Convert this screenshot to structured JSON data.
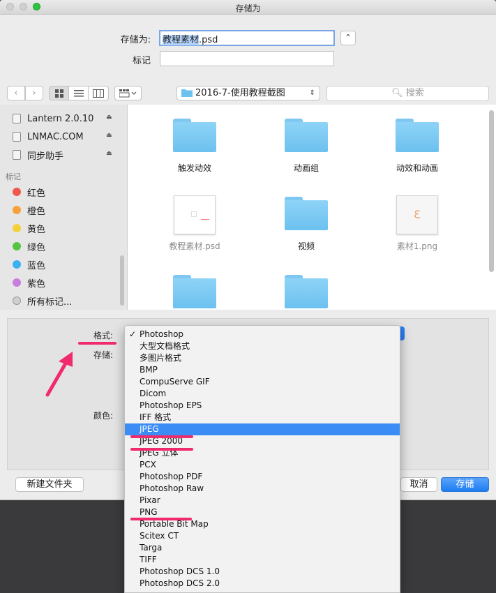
{
  "window": {
    "title": "存储为"
  },
  "save_as": {
    "label": "存储为:",
    "filename_selected": "教程素材",
    "filename_ext": ".psd"
  },
  "tags_field": {
    "label": "标记",
    "value": ""
  },
  "toolbar": {
    "location": "2016-7-使用教程截图",
    "search_placeholder": "搜索"
  },
  "sidebar": {
    "devices": [
      {
        "label": "Lantern 2.0.10"
      },
      {
        "label": "LNMAC.COM"
      },
      {
        "label": "同步助手"
      }
    ],
    "tags_header": "标记",
    "tags": [
      {
        "label": "红色",
        "color": "#f0584f"
      },
      {
        "label": "橙色",
        "color": "#f6a13b"
      },
      {
        "label": "黄色",
        "color": "#f4d13b"
      },
      {
        "label": "绿色",
        "color": "#58c542"
      },
      {
        "label": "蓝色",
        "color": "#3ab0f0"
      },
      {
        "label": "紫色",
        "color": "#c77ee0"
      },
      {
        "label": "所有标记...",
        "color": "#cfcfcf"
      }
    ]
  },
  "files": [
    {
      "name": "触发动效",
      "kind": "folder"
    },
    {
      "name": "动画组",
      "kind": "folder"
    },
    {
      "name": "动效和动画",
      "kind": "folder"
    },
    {
      "name": "教程素材.psd",
      "kind": "psd"
    },
    {
      "name": "视频",
      "kind": "folder"
    },
    {
      "name": "素材1.png",
      "kind": "png"
    },
    {
      "name": "",
      "kind": "folder"
    },
    {
      "name": "",
      "kind": "folder"
    }
  ],
  "options": {
    "format_label": "格式:",
    "save_label": "存储:",
    "color_label": "颜色:"
  },
  "format_menu": {
    "checked": "Photoshop",
    "highlighted": "JPEG",
    "items": [
      "Photoshop",
      "大型文档格式",
      "多图片格式",
      "BMP",
      "CompuServe GIF",
      "Dicom",
      "Photoshop EPS",
      "IFF 格式",
      "JPEG",
      "JPEG 2000",
      "JPEG 立体",
      "PCX",
      "Photoshop PDF",
      "Photoshop Raw",
      "Pixar",
      "PNG",
      "Portable Bit Map",
      "Scitex CT",
      "Targa",
      "TIFF",
      "Photoshop DCS 1.0",
      "Photoshop DCS 2.0"
    ]
  },
  "buttons": {
    "new_folder": "新建文件夹",
    "cancel": "取消",
    "save": "存储"
  },
  "colors": {
    "accent": "#3b8cf5",
    "annotation": "#f02a6c"
  }
}
